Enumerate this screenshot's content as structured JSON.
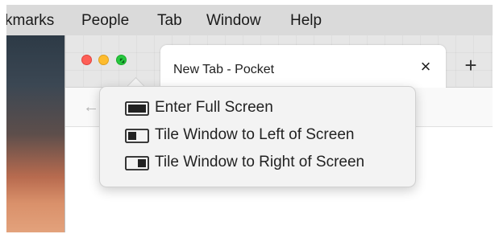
{
  "menubar": {
    "items": [
      "kmarks",
      "People",
      "Tab",
      "Window",
      "Help"
    ]
  },
  "browser": {
    "tab_title": "New Tab - Pocket",
    "tab_close_glyph": "×",
    "new_tab_glyph": "+",
    "back_glyph": "←"
  },
  "popover": {
    "items": [
      {
        "label": "Enter Full Screen",
        "icon": "fullscreen-icon"
      },
      {
        "label": "Tile Window to Left of Screen",
        "icon": "tile-left-icon"
      },
      {
        "label": "Tile Window to Right of Screen",
        "icon": "tile-right-icon"
      }
    ]
  },
  "colors": {
    "close": "#fe5f57",
    "minimize": "#febc2e",
    "zoom": "#28c840"
  }
}
